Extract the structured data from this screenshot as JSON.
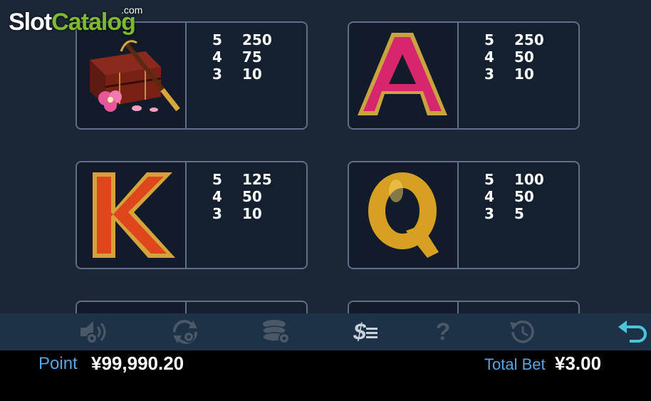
{
  "logo": {
    "part1": "Slot",
    "part2": "Catalog",
    "suffix": ".com"
  },
  "paytable": [
    {
      "symbol": "treasure-box-icon",
      "pays": [
        {
          "count": "5",
          "amount": "250"
        },
        {
          "count": "4",
          "amount": "75"
        },
        {
          "count": "3",
          "amount": "10"
        }
      ]
    },
    {
      "symbol": "letter-a-icon",
      "pays": [
        {
          "count": "5",
          "amount": "250"
        },
        {
          "count": "4",
          "amount": "50"
        },
        {
          "count": "3",
          "amount": "10"
        }
      ]
    },
    {
      "symbol": "letter-k-icon",
      "pays": [
        {
          "count": "5",
          "amount": "125"
        },
        {
          "count": "4",
          "amount": "50"
        },
        {
          "count": "3",
          "amount": "10"
        }
      ]
    },
    {
      "symbol": "letter-q-icon",
      "pays": [
        {
          "count": "5",
          "amount": "100"
        },
        {
          "count": "4",
          "amount": "50"
        },
        {
          "count": "3",
          "amount": "5"
        }
      ]
    }
  ],
  "letters": {
    "a": "A",
    "k": "K",
    "q": "Q"
  },
  "toolbar": [
    "sound-settings-icon",
    "autoplay-settings-icon",
    "bet-settings-icon",
    "paytable-icon",
    "help-icon",
    "history-icon",
    "back-icon"
  ],
  "toolbar_help_glyph": "?",
  "toolbar_pay_glyph": "$",
  "status": {
    "point_label": "Point",
    "point_value": "¥99,990.20",
    "bet_label": "Total Bet",
    "bet_value": "¥3.00"
  },
  "colors": {
    "accent_blue": "#56a6e3",
    "logo_green": "#7dba2f",
    "card_border": "#5f6e8a"
  }
}
